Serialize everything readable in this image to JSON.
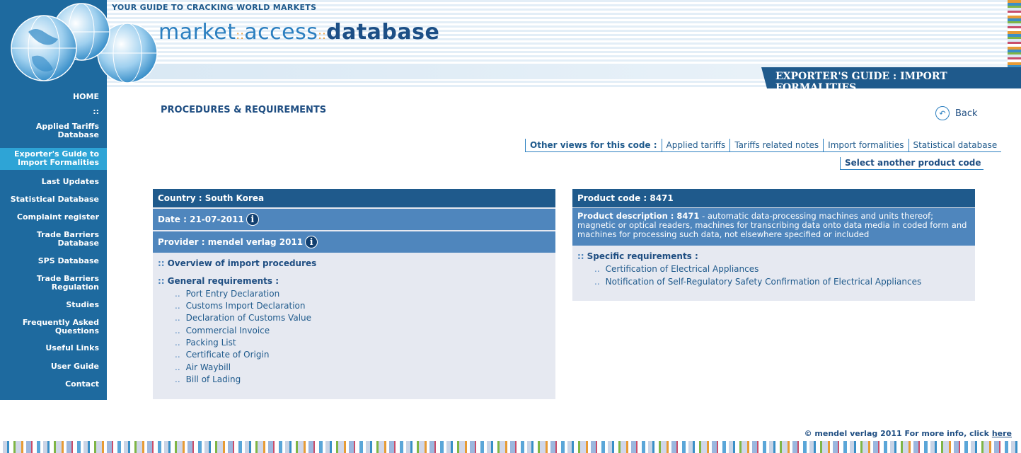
{
  "header": {
    "tagline": "YOUR GUIDE TO CRACKING WORLD MARKETS",
    "logo_part1": "market",
    "logo_part2": "access",
    "logo_part3": "database",
    "logo_dot": "::",
    "section_title": "EXPORTER'S GUIDE : IMPORT FORMALITIES"
  },
  "sidebar": {
    "items": [
      {
        "label": "HOME"
      },
      {
        "label": "::"
      },
      {
        "label": "Applied Tariffs Database"
      },
      {
        "label": "Exporter's Guide to Import Formalities",
        "active": true
      },
      {
        "label": "Last Updates"
      },
      {
        "label": "Statistical Database"
      },
      {
        "label": "Complaint register"
      },
      {
        "label": "Trade Barriers Database"
      },
      {
        "label": "SPS Database"
      },
      {
        "label": "Trade Barriers Regulation"
      },
      {
        "label": "Studies"
      },
      {
        "label": "Frequently Asked Questions"
      },
      {
        "label": "Useful Links"
      },
      {
        "label": "User Guide"
      },
      {
        "label": "Contact"
      }
    ]
  },
  "main": {
    "page_title": "PROCEDURES & REQUIREMENTS",
    "back_label": "Back",
    "other_views_label": "Other views for this code :",
    "other_views": [
      "Applied tariffs",
      "Tariffs related notes",
      "Import formalities",
      "Statistical database"
    ],
    "select_code_label": "Select another product code"
  },
  "left_panel": {
    "country": "Country : South Korea",
    "date": "Date : 21-07-2011",
    "provider": "Provider : mendel verlag 2011",
    "overview_label": "Overview of import procedures",
    "general_label": "General requirements :",
    "general_items": [
      "Port Entry Declaration",
      "Customs Import Declaration",
      "Declaration of Customs Value",
      "Commercial Invoice",
      "Packing List",
      "Certificate of Origin",
      "Air Waybill",
      "Bill of Lading"
    ]
  },
  "right_panel": {
    "product_code": "Product code : 8471",
    "desc_label": "Product description : 8471",
    "desc_text": " - automatic data-processing machines and units thereof; magnetic or optical readers, machines for transcribing data onto data media in coded form and machines for processing such data, not elsewhere specified or included",
    "specific_label": "Specific requirements :",
    "specific_items": [
      "Certification of Electrical Appliances",
      "Notification of Self-Regulatory Safety Confirmation of Electrical Appliances"
    ]
  },
  "footer": {
    "text": "© mendel verlag 2011 For more info, click ",
    "link": "here"
  },
  "icons": {
    "info": "i",
    "bullet_double": "::",
    "bullet_dots": ".."
  },
  "colors": {
    "brand_dark": "#1f5a8c",
    "brand_mid": "#4f86bd",
    "sidebar": "#1e6a9f",
    "sidebar_active": "#2ea4d6",
    "panel_bg": "#e6e9f1"
  }
}
